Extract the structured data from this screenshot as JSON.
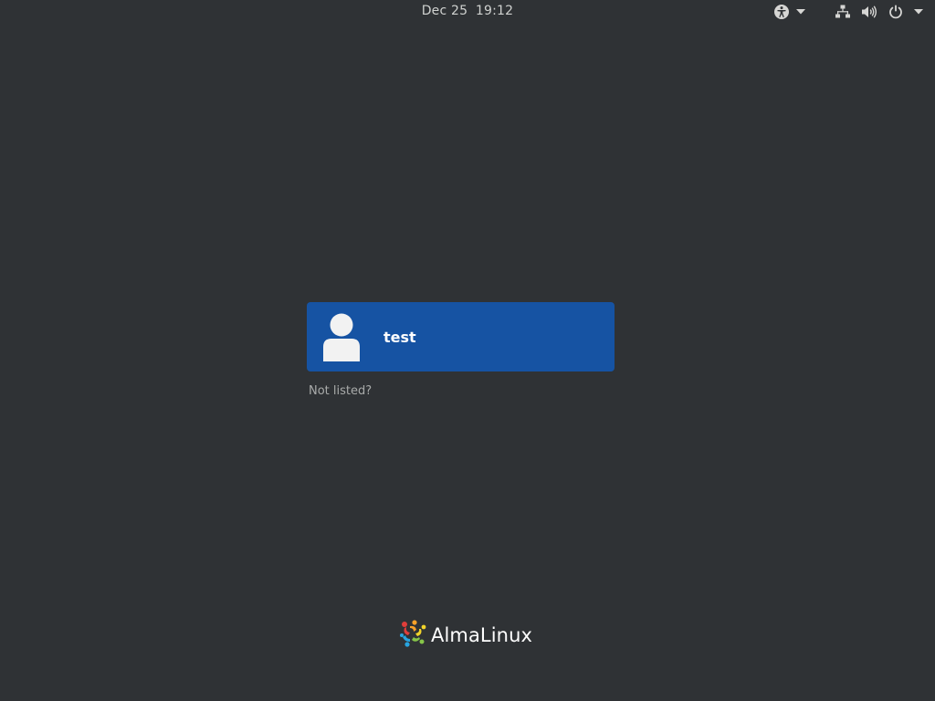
{
  "panel": {
    "date": "Dec 25",
    "time": "19:12"
  },
  "users": [
    {
      "name": "test"
    }
  ],
  "not_listed_label": "Not listed?",
  "brand": {
    "name": "AlmaLinux",
    "colors": {
      "red": "#e03e3a",
      "orange": "#f7a129",
      "yellow": "#f2d42a",
      "green": "#86c549",
      "blue": "#27a4e0"
    }
  },
  "icons": {
    "accessibility": "accessibility-icon",
    "network": "network-wired-icon",
    "volume": "volume-icon",
    "power": "power-icon",
    "dropdown": "chevron-down-icon",
    "avatar": "user-avatar-icon"
  },
  "colors": {
    "background": "#2f3235",
    "user_card": "#1653a3",
    "panel_text": "#cfd1cf",
    "muted_text": "#a9abaa"
  }
}
